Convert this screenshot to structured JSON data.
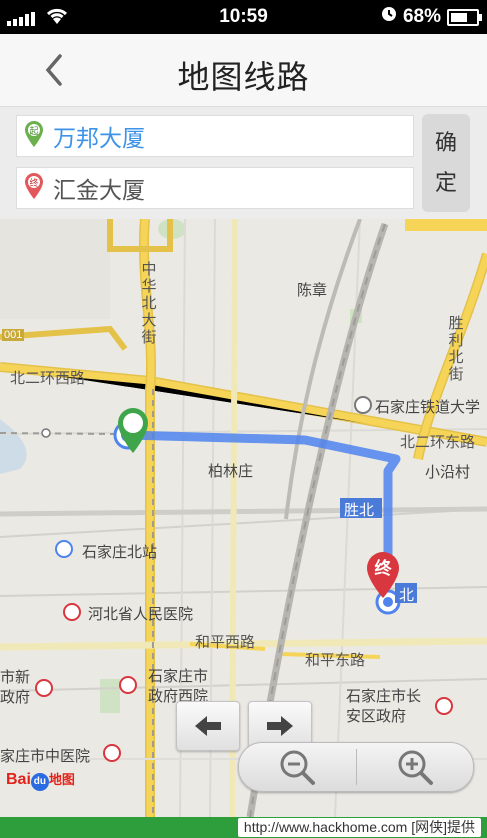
{
  "status_bar": {
    "time": "10:59",
    "battery_percent": "68%",
    "battery_level": 0.68
  },
  "nav": {
    "title": "地图线路"
  },
  "route": {
    "start_badge": "起",
    "end_badge": "终",
    "start_value": "万邦大厦",
    "end_value": "汇金大厦",
    "confirm_char_1": "确",
    "confirm_char_2": "定"
  },
  "map": {
    "labels": {
      "chenzhang": "陈章",
      "zhonghua_north": "中华北大街",
      "shengli_north": "胜利北街",
      "north_second_ring_west": "北二环西路",
      "north_second_ring_east": "北二环东路",
      "railway_university": "石家庄铁道大学",
      "bailinzhuang": "柏林庄",
      "xiaoyancun": "小沿村",
      "shengbei": "胜北",
      "north_station": "石家庄北站",
      "hebei_hospital": "河北省人民医院",
      "heping_west": "和平西路",
      "heping_east": "和平东路",
      "city_new_gov": "市新政府",
      "city_gov": "石家庄市政府西院",
      "chang_an_gov": "石家庄市长安区政府",
      "central_hospital": "家庄市中医院",
      "north_marker": "北",
      "road_001": "001",
      "end_marker": "终"
    },
    "logo_text": "Bai",
    "logo_du": "du",
    "logo_map": "地图"
  },
  "source_tag": "http://www.hackhome.com [网侠]提供",
  "colors": {
    "route": "#5b8ff2",
    "primary_road": "#f6cf48",
    "start_green": "#3fa54a",
    "end_red": "#d8373f",
    "link_blue": "#3d93e8"
  }
}
